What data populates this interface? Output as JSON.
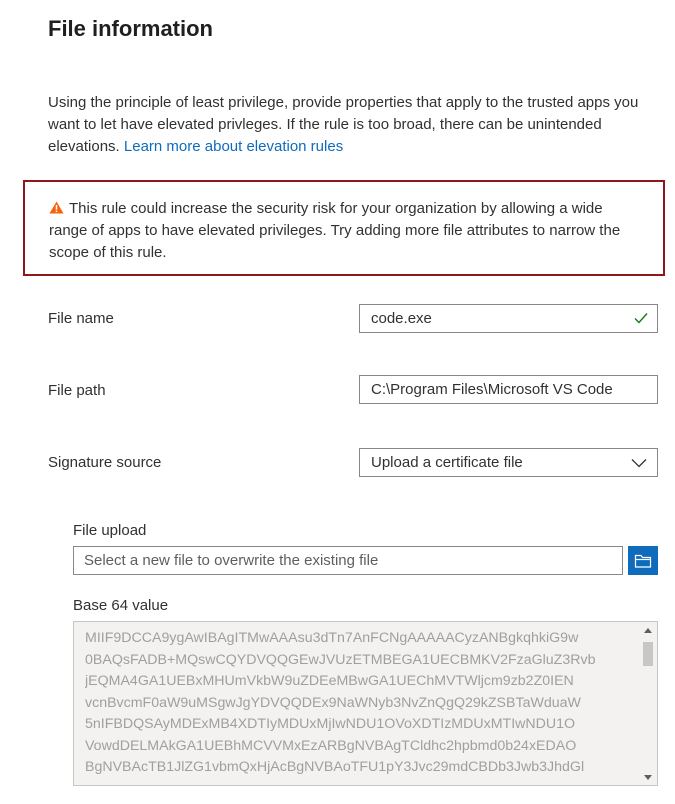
{
  "header": {
    "title": "File information"
  },
  "intro": {
    "text": "Using the principle of least privilege, provide properties that apply to the trusted apps you want to let have elevated privleges. If the rule is too broad, there can be unintended elevations. ",
    "link": "Learn more about elevation rules"
  },
  "warning": {
    "icon": "warning-triangle-icon",
    "color": "#f7630c",
    "border_color": "#8b1a1e",
    "text": "This rule could increase the security risk for your organization by allowing a wide range of apps to have elevated privileges. Try adding more file attributes to narrow the scope of this rule."
  },
  "fields": {
    "file_name": {
      "label": "File name",
      "value": "code.exe",
      "valid": true
    },
    "file_path": {
      "label": "File path",
      "value": "C:\\Program Files\\Microsoft VS Code"
    },
    "signature_source": {
      "label": "Signature source",
      "value": "Upload a certificate file"
    }
  },
  "upload": {
    "label": "File upload",
    "placeholder": "Select a new file to overwrite the existing file",
    "button_icon": "folder-icon",
    "accent": "#0f6cbd"
  },
  "base64": {
    "label": "Base 64 value",
    "lines": [
      "MIIF9DCCA9ygAwIBAgITMwAAAsu3dTn7AnFCNgAAAAACyzANBgkqhkiG9w",
      "0BAQsFADB+MQswCQYDVQQGEwJVUzETMBEGA1UECBMKV2FzaGluZ3Rvb",
      "jEQMA4GA1UEBxMHUmVkbW9uZDEeMBwGA1UEChMVTWljcm9zb2Z0IEN",
      "vcnBvcmF0aW9uMSgwJgYDVQQDEx9NaWNyb3NvZnQgQ29kZSBTaWduaW",
      "5nIFBDQSAyMDExMB4XDTIyMDUxMjIwNDU1OVoXDTIzMDUxMTIwNDU1O",
      "VowdDELMAkGA1UEBhMCVVMxEzARBgNVBAgTCldhc2hpbmd0b24xEDAO",
      "BgNVBAcTB1JlZG1vbmQxHjAcBgNVBAoTFU1pY3Jvc29mdCBDb3Jwb3JhdGl"
    ]
  }
}
